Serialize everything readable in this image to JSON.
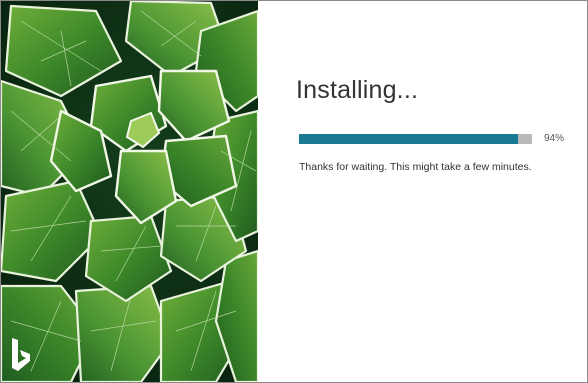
{
  "installer": {
    "title": "Installing...",
    "progress": {
      "value": 0.94,
      "label": "94%"
    },
    "status_message": "Thanks for waiting. This might take a few minutes."
  },
  "hero": {
    "logo_icon": "bing-logo-icon",
    "image_subject": "succulent-plant"
  },
  "colors": {
    "progress_fill": "#1a7a94",
    "progress_track": "#b9b9b9",
    "text": "#333333"
  }
}
